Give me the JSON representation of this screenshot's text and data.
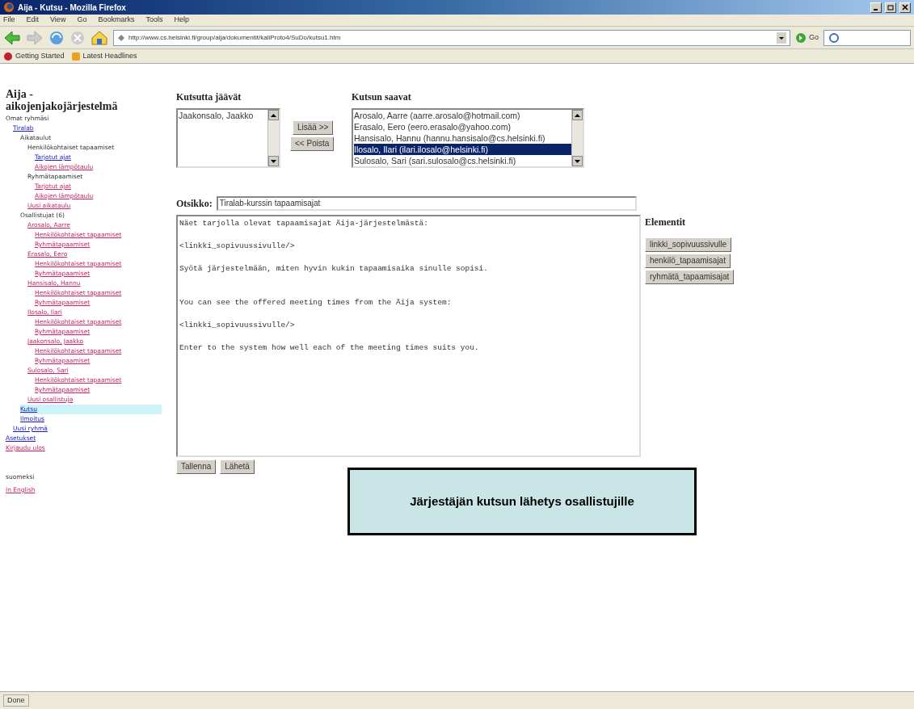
{
  "window": {
    "title": "Aija - Kutsu - Mozilla Firefox"
  },
  "menu": [
    "File",
    "Edit",
    "View",
    "Go",
    "Bookmarks",
    "Tools",
    "Help"
  ],
  "address_bar": {
    "value": "http://www.cs.helsinki.fi/group/aija/dokumentit/kaliProto4/SuDo/kutsu1.htm"
  },
  "go_button": "Go",
  "bookmarks": [
    "Getting Started",
    "Latest Headlines"
  ],
  "sidebar": {
    "title": "Aija - aikojenjakojärjestelmä",
    "tree": [
      {
        "label": "Omat ryhmäsi",
        "kind": "label",
        "selected": false,
        "children": [
          {
            "label": "Tiralab",
            "kind": "link",
            "selected": false,
            "children": [
              {
                "label": "Aikataulut",
                "kind": "label",
                "selected": false,
                "children": [
                  {
                    "label": "Henkilökohtaiset tapaamiset",
                    "kind": "label",
                    "selected": false,
                    "children": [
                      {
                        "label": "Tarjotut ajat",
                        "kind": "link",
                        "selected": false
                      },
                      {
                        "label": "Aikojen lämpötaulu",
                        "kind": "visited",
                        "selected": false
                      }
                    ]
                  },
                  {
                    "label": "Ryhmätapaamiset",
                    "kind": "label",
                    "selected": false,
                    "children": [
                      {
                        "label": "Tarjotut ajat",
                        "kind": "visited",
                        "selected": false
                      },
                      {
                        "label": "Aikojen lämpötaulu",
                        "kind": "visited",
                        "selected": false
                      }
                    ]
                  },
                  {
                    "label": "Uusi aikataulu",
                    "kind": "visited",
                    "selected": false
                  }
                ]
              },
              {
                "label": "Osallistujat (6)",
                "kind": "label",
                "selected": false,
                "children": [
                  {
                    "label": "Arosalo, Aarre",
                    "kind": "visited",
                    "selected": false,
                    "children": [
                      {
                        "label": "Henkilökohtaiset tapaamiset",
                        "kind": "visited",
                        "selected": false
                      },
                      {
                        "label": "Ryhmätapaamiset",
                        "kind": "visited",
                        "selected": false
                      }
                    ]
                  },
                  {
                    "label": "Erasalo, Eero",
                    "kind": "visited",
                    "selected": false,
                    "children": [
                      {
                        "label": "Henkilökohtaiset tapaamiset",
                        "kind": "visited",
                        "selected": false
                      },
                      {
                        "label": "Ryhmätapaamiset",
                        "kind": "visited",
                        "selected": false
                      }
                    ]
                  },
                  {
                    "label": "Hansisalo, Hannu",
                    "kind": "visited",
                    "selected": false,
                    "children": [
                      {
                        "label": "Henkilökohtaiset tapaamiset",
                        "kind": "visited",
                        "selected": false
                      },
                      {
                        "label": "Ryhmätapaamiset",
                        "kind": "visited",
                        "selected": false
                      }
                    ]
                  },
                  {
                    "label": "Ilosalo, Ilari",
                    "kind": "visited",
                    "selected": false,
                    "children": [
                      {
                        "label": "Henkilökohtaiset tapaamiset",
                        "kind": "visited",
                        "selected": false
                      },
                      {
                        "label": "Ryhmätapaamiset",
                        "kind": "visited",
                        "selected": false
                      }
                    ]
                  },
                  {
                    "label": "Jaakonsalo, Jaakko",
                    "kind": "visited",
                    "selected": false,
                    "children": [
                      {
                        "label": "Henkilökohtaiset tapaamiset",
                        "kind": "visited",
                        "selected": false
                      },
                      {
                        "label": "Ryhmätapaamiset",
                        "kind": "visited",
                        "selected": false
                      }
                    ]
                  },
                  {
                    "label": "Sulosalo, Sari",
                    "kind": "visited",
                    "selected": false,
                    "children": [
                      {
                        "label": "Henkilökohtaiset tapaamiset",
                        "kind": "visited",
                        "selected": false
                      },
                      {
                        "label": "Ryhmätapaamiset",
                        "kind": "visited",
                        "selected": false
                      }
                    ]
                  },
                  {
                    "label": "Uusi osallistuja",
                    "kind": "visited",
                    "selected": false
                  }
                ]
              },
              {
                "label": "Kutsu",
                "kind": "link",
                "selected": true
              },
              {
                "label": "Ilmoitus",
                "kind": "link",
                "selected": false
              }
            ]
          },
          {
            "label": "Uusi ryhmä",
            "kind": "link",
            "selected": false
          }
        ]
      },
      {
        "label": "Asetukset",
        "kind": "link",
        "selected": false
      },
      {
        "label": "Kirjaudu ulos",
        "kind": "visited",
        "selected": false
      }
    ],
    "languages": [
      {
        "label": "suomeksi",
        "kind": "label"
      },
      {
        "label": "In English",
        "kind": "visited"
      }
    ]
  },
  "uninvited": {
    "heading": "Kutsutta jäävät",
    "options": [
      {
        "label": "Jaakonsalo, Jaakko",
        "selected": false
      }
    ]
  },
  "add_button": "Lisää >>",
  "remove_button": "<< Poista",
  "invited": {
    "heading": "Kutsun saavat",
    "options": [
      {
        "label": "Arosalo, Aarre (aarre.arosalo@hotmail.com)",
        "selected": false
      },
      {
        "label": "Erasalo, Eero (eero.erasalo@yahoo.com)",
        "selected": false
      },
      {
        "label": "Hansisalo, Hannu (hannu.hansisalo@cs.helsinki.fi)",
        "selected": false
      },
      {
        "label": "Ilosalo, Ilari (ilari.ilosalo@helsinki.fi)",
        "selected": true
      },
      {
        "label": "Sulosalo, Sari (sari.sulosalo@cs.helsinki.fi)",
        "selected": false
      }
    ]
  },
  "subject": {
    "label": "Otsikko:",
    "value": "Tiralab-kurssin tapaamisajat"
  },
  "message": {
    "value": "Näet tarjolla olevat tapaamisajat Äija-järjestelmästä:\n\n<linkki_sopivuussivulle/>\n\nSyötä järjestelmään, miten hyvin kukin tapaamisaika sinulle sopisi.\n\n\nYou can see the offered meeting times from the Äija system:\n\n<linkki_sopivuussivulle/>\n\nEnter to the system how well each of the meeting times suits you."
  },
  "elements": {
    "heading": "Elementit",
    "buttons": [
      "linkki_sopivuussivulle",
      "henkilö_tapaamisajat",
      "ryhmätä_tapaamisajat"
    ]
  },
  "actions": [
    "Tallenna",
    "Lähetä"
  ],
  "caption": "Järjestäjän kutsun lähetys osallistujille",
  "status_bar": "Done"
}
